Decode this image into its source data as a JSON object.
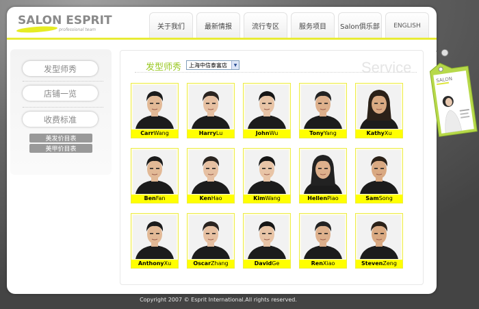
{
  "logo": {
    "text": "SALON ESPRIT",
    "sub": "professional team"
  },
  "nav": [
    "关于我们",
    "最新情报",
    "流行专区",
    "服务项目",
    "Salon俱乐部",
    "ENGLISH"
  ],
  "sidebar": {
    "items": [
      "发型师秀",
      "店铺一览",
      "收费标准"
    ],
    "sub_items": [
      "美发价目表",
      "美甲价目表"
    ]
  },
  "content": {
    "title": "发型师秀",
    "store_select": "上海中信泰富店",
    "watermark": "Service"
  },
  "stylists": [
    {
      "first": "Carr",
      "last": "Wang"
    },
    {
      "first": "Harry",
      "last": "Lu"
    },
    {
      "first": "John",
      "last": "Wu"
    },
    {
      "first": "Tony",
      "last": "Yang"
    },
    {
      "first": "Kathy",
      "last": "Xu"
    },
    {
      "first": "Ben",
      "last": "Fan"
    },
    {
      "first": "Ken",
      "last": "Hao"
    },
    {
      "first": "Kim",
      "last": "Wang"
    },
    {
      "first": "Hellen",
      "last": "Piao"
    },
    {
      "first": "Sam",
      "last": "Song"
    },
    {
      "first": "Anthony",
      "last": "Xu"
    },
    {
      "first": "Oscar",
      "last": "Zhang"
    },
    {
      "first": "David",
      "last": "Ge"
    },
    {
      "first": "Ren",
      "last": "Xiao"
    },
    {
      "first": "Steven",
      "last": "Zeng"
    }
  ],
  "footer": "Copyright 2007 © Esprit International.All rights reserved."
}
